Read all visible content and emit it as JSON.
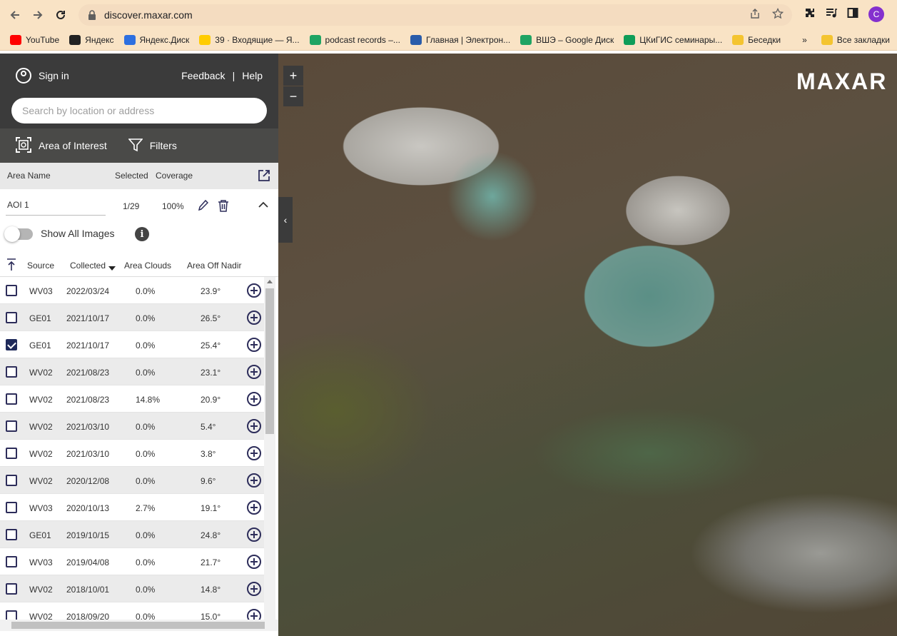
{
  "browser": {
    "url": "discover.maxar.com",
    "avatar_letter": "C",
    "bookmarks": [
      {
        "label": "YouTube",
        "color": "#ff0000"
      },
      {
        "label": "Яндекс",
        "color": "#222222"
      },
      {
        "label": "Яндекс.Диск",
        "color": "#2d6fe0"
      },
      {
        "label": "39 · Входящие — Я...",
        "color": "#ffcc00"
      },
      {
        "label": "podcast records –...",
        "color": "#1fa463"
      },
      {
        "label": "Главная | Электрон...",
        "color": "#2a5caa"
      },
      {
        "label": "ВШЭ – Google Диск",
        "color": "#1fa463"
      },
      {
        "label": "ЦКиГИС семинары...",
        "color": "#0f9d58"
      },
      {
        "label": "Беседки",
        "color": "#f4c430"
      }
    ],
    "bookmarks_more": "»",
    "bookmarks_all": "Все закладки"
  },
  "header": {
    "signin_label": "Sign in",
    "feedback_label": "Feedback",
    "separator": "|",
    "help_label": "Help",
    "search_placeholder": "Search by location or address"
  },
  "tabs": {
    "aoi_label": "Area of Interest",
    "filters_label": "Filters"
  },
  "aoi_table": {
    "col_name": "Area Name",
    "col_selected": "Selected",
    "col_coverage": "Coverage",
    "row": {
      "name": "AOI 1",
      "selected": "1/29",
      "coverage": "100%"
    }
  },
  "show_all_images_label": "Show All Images",
  "info_icon_glyph": "i",
  "images_table": {
    "col_source": "Source",
    "col_collected": "Collected",
    "col_clouds": "Area Clouds",
    "col_nadir": "Area Off Nadir",
    "rows": [
      {
        "source": "WV03",
        "collected": "2022/03/24",
        "clouds": "0.0%",
        "nadir": "23.9°",
        "checked": false
      },
      {
        "source": "GE01",
        "collected": "2021/10/17",
        "clouds": "0.0%",
        "nadir": "26.5°",
        "checked": false
      },
      {
        "source": "GE01",
        "collected": "2021/10/17",
        "clouds": "0.0%",
        "nadir": "25.4°",
        "checked": true
      },
      {
        "source": "WV02",
        "collected": "2021/08/23",
        "clouds": "0.0%",
        "nadir": "23.1°",
        "checked": false
      },
      {
        "source": "WV02",
        "collected": "2021/08/23",
        "clouds": "14.8%",
        "nadir": "20.9°",
        "checked": false
      },
      {
        "source": "WV02",
        "collected": "2021/03/10",
        "clouds": "0.0%",
        "nadir": "5.4°",
        "checked": false
      },
      {
        "source": "WV02",
        "collected": "2021/03/10",
        "clouds": "0.0%",
        "nadir": "3.8°",
        "checked": false
      },
      {
        "source": "WV02",
        "collected": "2020/12/08",
        "clouds": "0.0%",
        "nadir": "9.6°",
        "checked": false
      },
      {
        "source": "WV03",
        "collected": "2020/10/13",
        "clouds": "2.7%",
        "nadir": "19.1°",
        "checked": false
      },
      {
        "source": "GE01",
        "collected": "2019/10/15",
        "clouds": "0.0%",
        "nadir": "24.8°",
        "checked": false
      },
      {
        "source": "WV03",
        "collected": "2019/04/08",
        "clouds": "0.0%",
        "nadir": "21.7°",
        "checked": false
      },
      {
        "source": "WV02",
        "collected": "2018/10/01",
        "clouds": "0.0%",
        "nadir": "14.8°",
        "checked": false
      },
      {
        "source": "WV02",
        "collected": "2018/09/20",
        "clouds": "0.0%",
        "nadir": "15.0°",
        "checked": false
      }
    ]
  },
  "map": {
    "brand": "MAXAR",
    "zoom_in": "+",
    "zoom_out": "−",
    "collapse_glyph": "‹"
  }
}
